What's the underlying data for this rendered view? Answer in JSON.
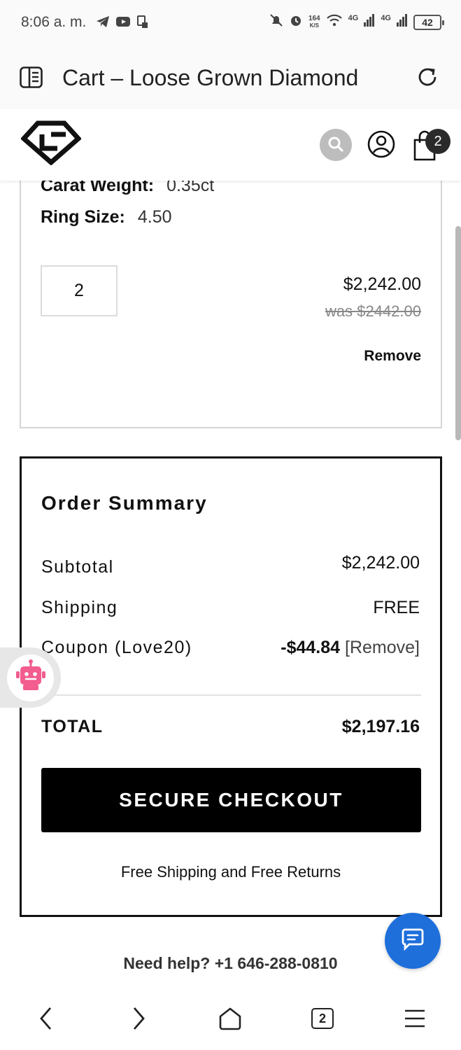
{
  "status_bar": {
    "time": "8:06 a. m.",
    "net_speed_value": "164",
    "net_speed_unit": "K/S",
    "signal_1": "4G",
    "signal_2": "4G",
    "battery": "42",
    "icons": [
      "telegram-icon",
      "youtube-icon",
      "sim-icon",
      "mute-icon",
      "alarm-icon",
      "wifi-icon",
      "signal-icon",
      "battery-icon"
    ]
  },
  "browser": {
    "page_title": "Cart – Loose Grown Diamond",
    "icons": [
      "tab-panel-icon",
      "refresh-icon"
    ]
  },
  "site_header": {
    "cart_count": "2",
    "icons": [
      "logo-diamond-icon",
      "search-icon",
      "account-icon",
      "shopping-bag-icon"
    ]
  },
  "cart_item": {
    "specs": [
      {
        "label": "Carat Weight:",
        "value": "0.35ct"
      },
      {
        "label": "Ring Size:",
        "value": "4.50"
      }
    ],
    "quantity": "2",
    "price": "$2,242.00",
    "was_price": "was $2442.00",
    "remove_label": "Remove"
  },
  "order_summary": {
    "title": "Order Summary",
    "subtotal_label": "Subtotal",
    "subtotal_value": "$2,242.00",
    "shipping_label": "Shipping",
    "shipping_value": "FREE",
    "coupon_label": "Coupon (Love20)",
    "coupon_amount": "-$44.84",
    "coupon_remove": "[Remove]",
    "total_label": "TOTAL",
    "total_value": "$2,197.16",
    "checkout_label": "SECURE CHECKOUT",
    "note": "Free Shipping and Free Returns"
  },
  "help": {
    "text": "Need help? +1 646-288-0810"
  },
  "nav_bar": {
    "tabs_count": "2",
    "icons": [
      "back-icon",
      "forward-icon",
      "home-icon",
      "tabs-icon",
      "menu-icon"
    ]
  },
  "colors": {
    "chat_button": "#1f6fdb",
    "checkout_button": "#000000",
    "bot_icon": "#f25c8f"
  }
}
